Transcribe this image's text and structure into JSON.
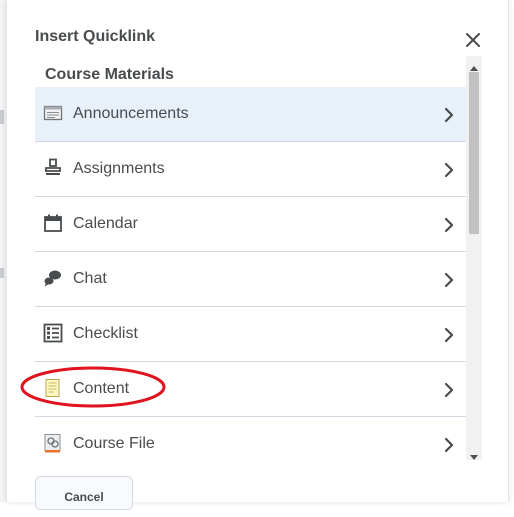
{
  "dialog": {
    "title": "Insert Quicklink",
    "close_icon": "close-icon",
    "section_heading": "Course Materials",
    "items": [
      {
        "label": "Announcements",
        "icon": "announcements-icon",
        "active": true
      },
      {
        "label": "Assignments",
        "icon": "assignments-icon"
      },
      {
        "label": "Calendar",
        "icon": "calendar-icon"
      },
      {
        "label": "Chat",
        "icon": "chat-icon"
      },
      {
        "label": "Checklist",
        "icon": "checklist-icon"
      },
      {
        "label": "Content",
        "icon": "content-icon",
        "highlighted": true
      },
      {
        "label": "Course File",
        "icon": "course-file-icon"
      }
    ],
    "cancel_label": "Cancel"
  },
  "colors": {
    "active_row": "#e8f1f9",
    "annotation": "#e0131f",
    "divider": "#d3d9e3",
    "text": "#494c4e"
  }
}
